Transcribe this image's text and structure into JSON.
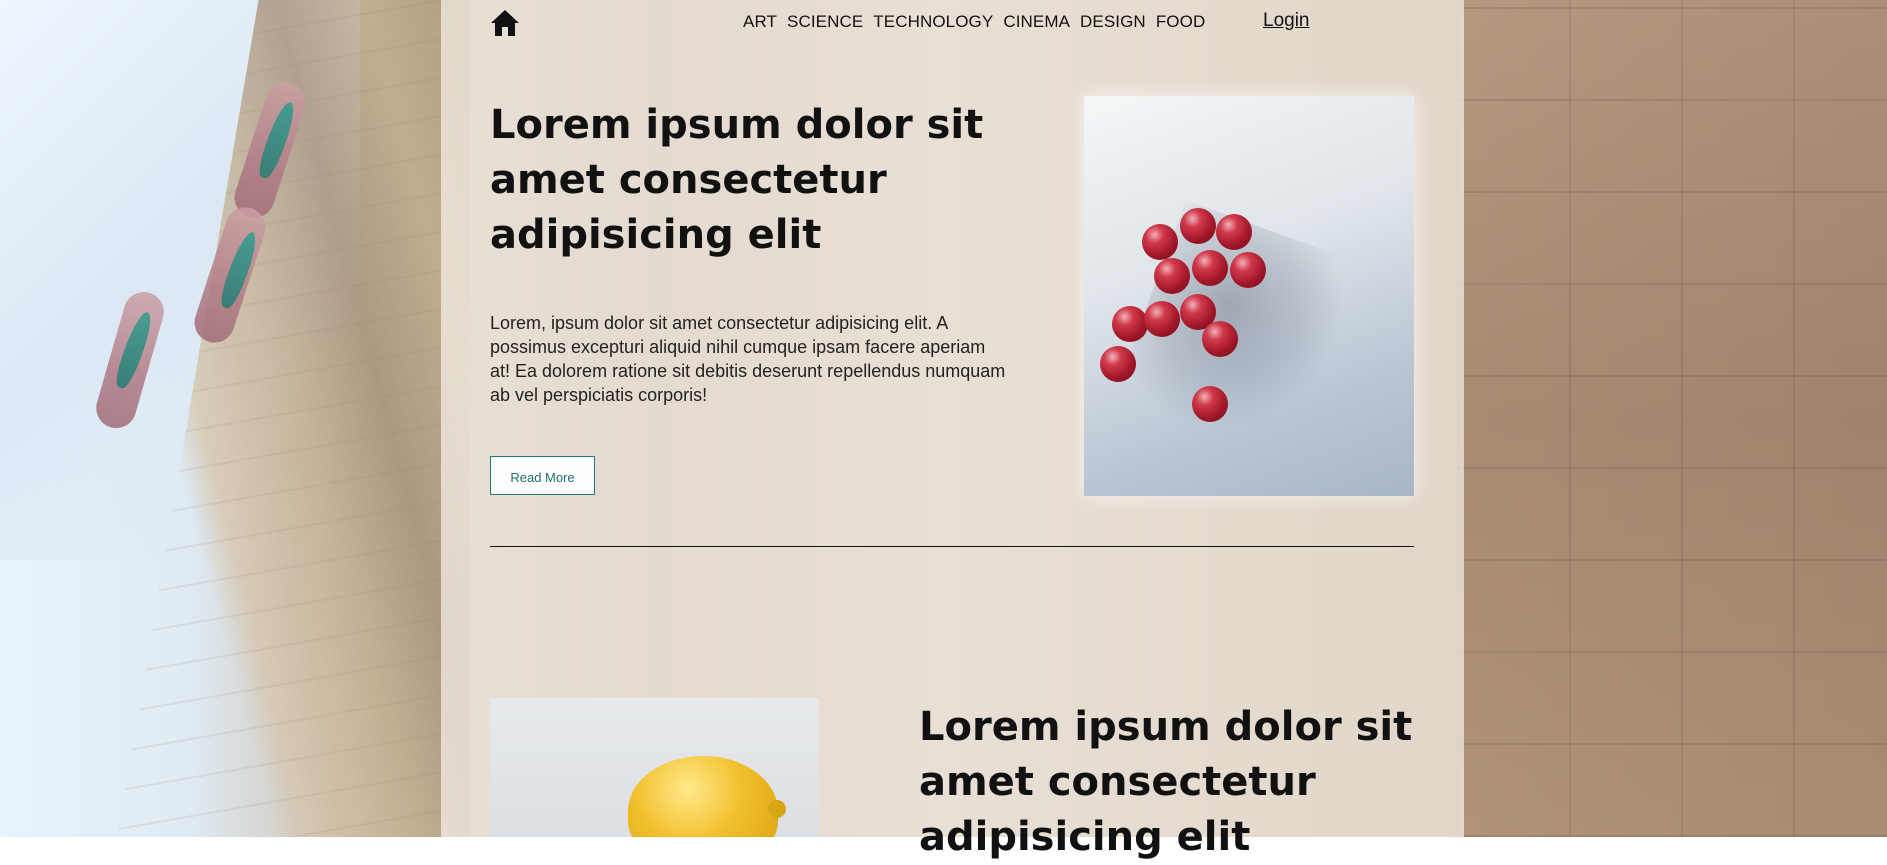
{
  "nav": {
    "items": [
      "ART",
      "SCIENCE",
      "TECHNOLOGY",
      "CINEMA",
      "DESIGN",
      "FOOD"
    ],
    "login_label": "Login"
  },
  "articles": [
    {
      "title": "Lorem ipsum dolor sit amet consectetur adipisicing elit",
      "text": "Lorem, ipsum dolor sit amet consectetur adipisicing elit. A possimus excepturi aliquid nihil cumque ipsam facere aperiam at! Ea dolorem ratione sit debitis deserunt repellendus numquam ab vel perspiciatis corporis!",
      "button_label": "Read More"
    },
    {
      "title": "Lorem ipsum dolor sit amet consectetur adipisicing elit"
    }
  ],
  "icons": {
    "home": "home-icon"
  },
  "colors": {
    "accent": "#1f7a78"
  }
}
